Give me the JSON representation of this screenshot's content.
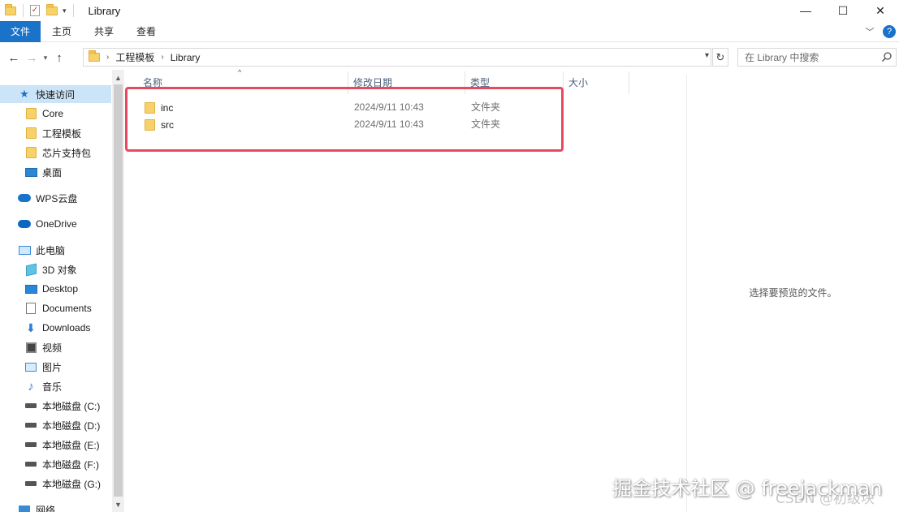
{
  "window": {
    "title": "Library",
    "controls": {
      "minimize": "—",
      "maximize": "☐",
      "close": "✕"
    }
  },
  "ribbon": {
    "tabs": [
      "文件",
      "主页",
      "共享",
      "查看"
    ]
  },
  "address": {
    "breadcrumb": [
      "工程模板",
      "Library"
    ],
    "search_placeholder": "在 Library 中搜索"
  },
  "sidebar": {
    "items": [
      {
        "label": "快速访问",
        "icon": "star-icon"
      },
      {
        "label": "Core",
        "icon": "folder-icon"
      },
      {
        "label": "工程模板",
        "icon": "folder-icon"
      },
      {
        "label": "芯片支持包",
        "icon": "folder-icon"
      },
      {
        "label": "桌面",
        "icon": "desktop-icon"
      },
      {
        "label": "WPS云盘",
        "icon": "cloud-icon"
      },
      {
        "label": "OneDrive",
        "icon": "onedrive-icon"
      },
      {
        "label": "此电脑",
        "icon": "pc-icon"
      },
      {
        "label": "3D 对象",
        "icon": "3d-objects-icon"
      },
      {
        "label": "Desktop",
        "icon": "desktop-icon"
      },
      {
        "label": "Documents",
        "icon": "documents-icon"
      },
      {
        "label": "Downloads",
        "icon": "download-icon"
      },
      {
        "label": "视频",
        "icon": "video-icon"
      },
      {
        "label": "图片",
        "icon": "pictures-icon"
      },
      {
        "label": "音乐",
        "icon": "music-icon"
      },
      {
        "label": "本地磁盘 (C:)",
        "icon": "drive-icon"
      },
      {
        "label": "本地磁盘 (D:)",
        "icon": "drive-icon"
      },
      {
        "label": "本地磁盘 (E:)",
        "icon": "drive-icon"
      },
      {
        "label": "本地磁盘 (F:)",
        "icon": "drive-icon"
      },
      {
        "label": "本地磁盘 (G:)",
        "icon": "drive-icon"
      },
      {
        "label": "网络",
        "icon": "network-icon"
      }
    ]
  },
  "columns": {
    "name": "名称",
    "modified": "修改日期",
    "type": "类型",
    "size": "大小"
  },
  "files": [
    {
      "name": "inc",
      "modified": "2024/9/11 10:43",
      "type": "文件夹"
    },
    {
      "name": "src",
      "modified": "2024/9/11 10:43",
      "type": "文件夹"
    }
  ],
  "preview": {
    "message": "选择要预览的文件。"
  },
  "watermark": {
    "line1": "掘金技术社区 @ freejackman",
    "line2": "CSDN @初级块"
  },
  "colors": {
    "accent": "#1a73c8",
    "selection": "#cce4f7",
    "highlight_box": "#e9495f"
  }
}
